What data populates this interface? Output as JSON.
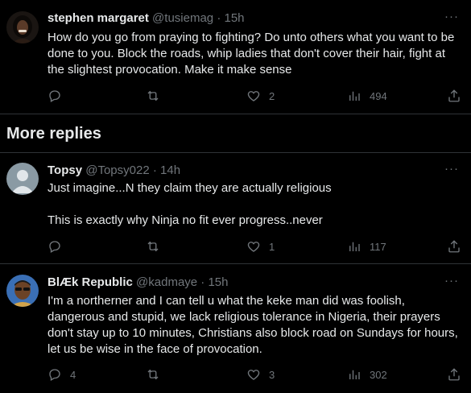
{
  "tweets": [
    {
      "name": "stephen margaret",
      "handle": "@tusiemag",
      "dot": "·",
      "time": "15h",
      "text": "How do you go from praying to fighting? Do unto others what you want to be done to you. Block the roads, whip ladies that don't cover their hair, fight at the slightest provocation. Make it make sense",
      "replies": "",
      "retweets": "",
      "likes": "2",
      "views": "494"
    },
    {
      "name": "Topsy",
      "handle": "@Topsy022",
      "dot": "·",
      "time": "14h",
      "text": "Just imagine...N they claim they are actually religious\n\nThis is exactly why Ninja no fit ever progress..never",
      "replies": "",
      "retweets": "",
      "likes": "1",
      "views": "117"
    },
    {
      "name": "BlÆk Republic",
      "handle": "@kadmaye",
      "dot": "·",
      "time": "15h",
      "text": "I'm a northerner and I can tell u what the keke man did was foolish, dangerous and stupid, we lack religious tolerance in Nigeria, their prayers don't stay up to 10 minutes, Christians also block road on Sundays for hours, let us be wise in the face of provocation.",
      "replies": "4",
      "retweets": "",
      "likes": "3",
      "views": "302"
    }
  ],
  "section": {
    "title": "More replies"
  },
  "icons": {
    "more": "more-horizontal-icon",
    "reply": "reply-icon",
    "retweet": "retweet-icon",
    "like": "heart-icon",
    "views": "views-chart-icon",
    "share": "share-icon"
  },
  "colors": {
    "background": "#000000",
    "text": "#e7e9ea",
    "muted": "#71767b",
    "divider": "#2f3336"
  }
}
